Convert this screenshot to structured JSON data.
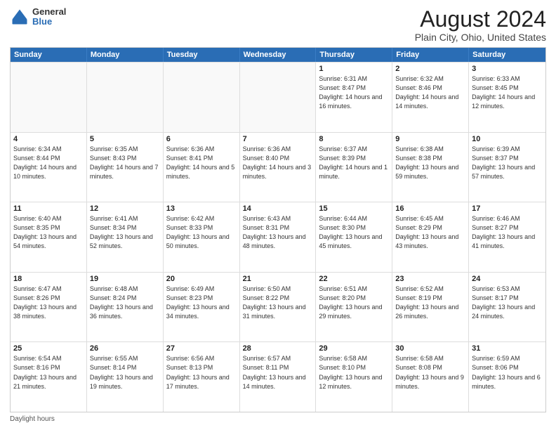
{
  "header": {
    "logo_general": "General",
    "logo_blue": "Blue",
    "title": "August 2024",
    "subtitle": "Plain City, Ohio, United States"
  },
  "calendar": {
    "days_of_week": [
      "Sunday",
      "Monday",
      "Tuesday",
      "Wednesday",
      "Thursday",
      "Friday",
      "Saturday"
    ],
    "rows": [
      [
        {
          "day": "",
          "info": ""
        },
        {
          "day": "",
          "info": ""
        },
        {
          "day": "",
          "info": ""
        },
        {
          "day": "",
          "info": ""
        },
        {
          "day": "1",
          "info": "Sunrise: 6:31 AM\nSunset: 8:47 PM\nDaylight: 14 hours and 16 minutes."
        },
        {
          "day": "2",
          "info": "Sunrise: 6:32 AM\nSunset: 8:46 PM\nDaylight: 14 hours and 14 minutes."
        },
        {
          "day": "3",
          "info": "Sunrise: 6:33 AM\nSunset: 8:45 PM\nDaylight: 14 hours and 12 minutes."
        }
      ],
      [
        {
          "day": "4",
          "info": "Sunrise: 6:34 AM\nSunset: 8:44 PM\nDaylight: 14 hours and 10 minutes."
        },
        {
          "day": "5",
          "info": "Sunrise: 6:35 AM\nSunset: 8:43 PM\nDaylight: 14 hours and 7 minutes."
        },
        {
          "day": "6",
          "info": "Sunrise: 6:36 AM\nSunset: 8:41 PM\nDaylight: 14 hours and 5 minutes."
        },
        {
          "day": "7",
          "info": "Sunrise: 6:36 AM\nSunset: 8:40 PM\nDaylight: 14 hours and 3 minutes."
        },
        {
          "day": "8",
          "info": "Sunrise: 6:37 AM\nSunset: 8:39 PM\nDaylight: 14 hours and 1 minute."
        },
        {
          "day": "9",
          "info": "Sunrise: 6:38 AM\nSunset: 8:38 PM\nDaylight: 13 hours and 59 minutes."
        },
        {
          "day": "10",
          "info": "Sunrise: 6:39 AM\nSunset: 8:37 PM\nDaylight: 13 hours and 57 minutes."
        }
      ],
      [
        {
          "day": "11",
          "info": "Sunrise: 6:40 AM\nSunset: 8:35 PM\nDaylight: 13 hours and 54 minutes."
        },
        {
          "day": "12",
          "info": "Sunrise: 6:41 AM\nSunset: 8:34 PM\nDaylight: 13 hours and 52 minutes."
        },
        {
          "day": "13",
          "info": "Sunrise: 6:42 AM\nSunset: 8:33 PM\nDaylight: 13 hours and 50 minutes."
        },
        {
          "day": "14",
          "info": "Sunrise: 6:43 AM\nSunset: 8:31 PM\nDaylight: 13 hours and 48 minutes."
        },
        {
          "day": "15",
          "info": "Sunrise: 6:44 AM\nSunset: 8:30 PM\nDaylight: 13 hours and 45 minutes."
        },
        {
          "day": "16",
          "info": "Sunrise: 6:45 AM\nSunset: 8:29 PM\nDaylight: 13 hours and 43 minutes."
        },
        {
          "day": "17",
          "info": "Sunrise: 6:46 AM\nSunset: 8:27 PM\nDaylight: 13 hours and 41 minutes."
        }
      ],
      [
        {
          "day": "18",
          "info": "Sunrise: 6:47 AM\nSunset: 8:26 PM\nDaylight: 13 hours and 38 minutes."
        },
        {
          "day": "19",
          "info": "Sunrise: 6:48 AM\nSunset: 8:24 PM\nDaylight: 13 hours and 36 minutes."
        },
        {
          "day": "20",
          "info": "Sunrise: 6:49 AM\nSunset: 8:23 PM\nDaylight: 13 hours and 34 minutes."
        },
        {
          "day": "21",
          "info": "Sunrise: 6:50 AM\nSunset: 8:22 PM\nDaylight: 13 hours and 31 minutes."
        },
        {
          "day": "22",
          "info": "Sunrise: 6:51 AM\nSunset: 8:20 PM\nDaylight: 13 hours and 29 minutes."
        },
        {
          "day": "23",
          "info": "Sunrise: 6:52 AM\nSunset: 8:19 PM\nDaylight: 13 hours and 26 minutes."
        },
        {
          "day": "24",
          "info": "Sunrise: 6:53 AM\nSunset: 8:17 PM\nDaylight: 13 hours and 24 minutes."
        }
      ],
      [
        {
          "day": "25",
          "info": "Sunrise: 6:54 AM\nSunset: 8:16 PM\nDaylight: 13 hours and 21 minutes."
        },
        {
          "day": "26",
          "info": "Sunrise: 6:55 AM\nSunset: 8:14 PM\nDaylight: 13 hours and 19 minutes."
        },
        {
          "day": "27",
          "info": "Sunrise: 6:56 AM\nSunset: 8:13 PM\nDaylight: 13 hours and 17 minutes."
        },
        {
          "day": "28",
          "info": "Sunrise: 6:57 AM\nSunset: 8:11 PM\nDaylight: 13 hours and 14 minutes."
        },
        {
          "day": "29",
          "info": "Sunrise: 6:58 AM\nSunset: 8:10 PM\nDaylight: 13 hours and 12 minutes."
        },
        {
          "day": "30",
          "info": "Sunrise: 6:58 AM\nSunset: 8:08 PM\nDaylight: 13 hours and 9 minutes."
        },
        {
          "day": "31",
          "info": "Sunrise: 6:59 AM\nSunset: 8:06 PM\nDaylight: 13 hours and 6 minutes."
        }
      ]
    ]
  },
  "footer": {
    "daylight_label": "Daylight hours"
  }
}
